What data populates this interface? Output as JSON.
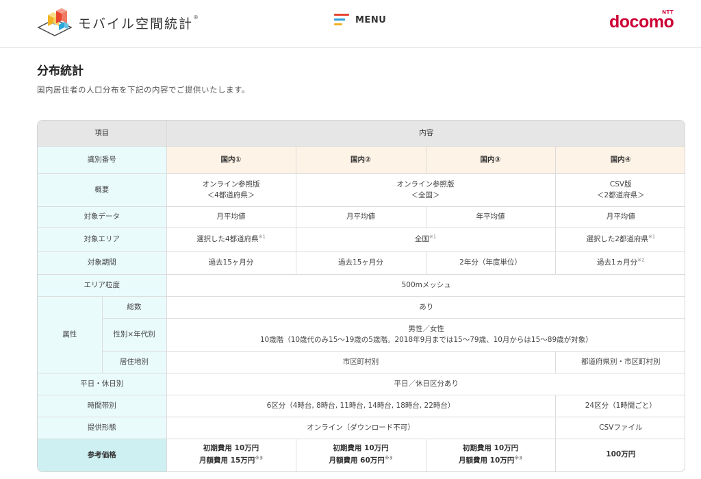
{
  "header": {
    "logo_text": "モバイル空間統計",
    "logo_mark": "®",
    "menu_label": "MENU",
    "brand_small": "NTT",
    "brand_name": "docomo",
    "colors": {
      "menu_red": "#e8442e",
      "menu_blue": "#2a9fd8",
      "menu_yellow": "#f0b323",
      "docomo_red": "#cc0033"
    }
  },
  "page": {
    "title": "分布統計",
    "description": "国内居住者の人口分布を下記の内容でご提供いたします。"
  },
  "table": {
    "head": {
      "item": "項目",
      "content": "内容"
    },
    "id_row": {
      "label": "識別番号",
      "c1": "国内①",
      "c2": "国内②",
      "c3": "国内③",
      "c4": "国内④"
    },
    "overview": {
      "label": "概要",
      "c1_l1": "オンライン参照版",
      "c1_l2": "＜4都道府県＞",
      "c23_l1": "オンライン参照版",
      "c23_l2": "＜全国＞",
      "c4_l1": "CSV版",
      "c4_l2": "＜2都道府県＞"
    },
    "data": {
      "label": "対象データ",
      "c1": "月平均値",
      "c2": "月平均値",
      "c3": "年平均値",
      "c4": "月平均値"
    },
    "area": {
      "label": "対象エリア",
      "c1": "選択した4都道府県",
      "c1_note": "※1",
      "c23": "全国",
      "c23_note": "※1",
      "c4": "選択した2都道府県",
      "c4_note": "※1"
    },
    "period": {
      "label": "対象期間",
      "c1": "過去15ヶ月分",
      "c2": "過去15ヶ月分",
      "c3": "2年分（年度単位）",
      "c4": "過去1ヵ月分",
      "c4_note": "※2"
    },
    "granularity": {
      "label": "エリア粒度",
      "value": "500mメッシュ"
    },
    "attributes": {
      "label": "属性",
      "total": {
        "label": "総数",
        "value": "あり"
      },
      "gender_age": {
        "label": "性別×年代別",
        "line1": "男性／女性",
        "line2": "10歳階（10歳代のみ15～19歳の5歳階。2018年9月までは15～79歳、10月からは15～89歳が対象）"
      },
      "residence": {
        "label": "居住地別",
        "c123": "市区町村別",
        "c4": "都道府県別・市区町村別"
      }
    },
    "weekday": {
      "label": "平日・休日別",
      "value": "平日／休日区分あり"
    },
    "time": {
      "label": "時間帯別",
      "c123": "6区分（4時台, 8時台, 11時台, 14時台, 18時台, 22時台）",
      "c4": "24区分（1時間ごと）"
    },
    "delivery": {
      "label": "提供形態",
      "c123": "オンライン（ダウンロード不可）",
      "c4": "CSVファイル"
    },
    "price": {
      "label": "参考価格",
      "c1_l1": "初期費用 10万円",
      "c1_l2": "月額費用 15万円",
      "c1_note": "※3",
      "c2_l1": "初期費用 10万円",
      "c2_l2": "月額費用 60万円",
      "c2_note": "※3",
      "c3_l1": "初期費用 10万円",
      "c3_l2": "月額費用 10万円",
      "c3_note": "※3",
      "c4": "100万円"
    },
    "colors": {
      "header_bg": "#e6e6e6",
      "label_bg": "#eafbfc",
      "label_strong_bg": "#cef0f2",
      "id_bg": "#fdf3e6"
    }
  }
}
